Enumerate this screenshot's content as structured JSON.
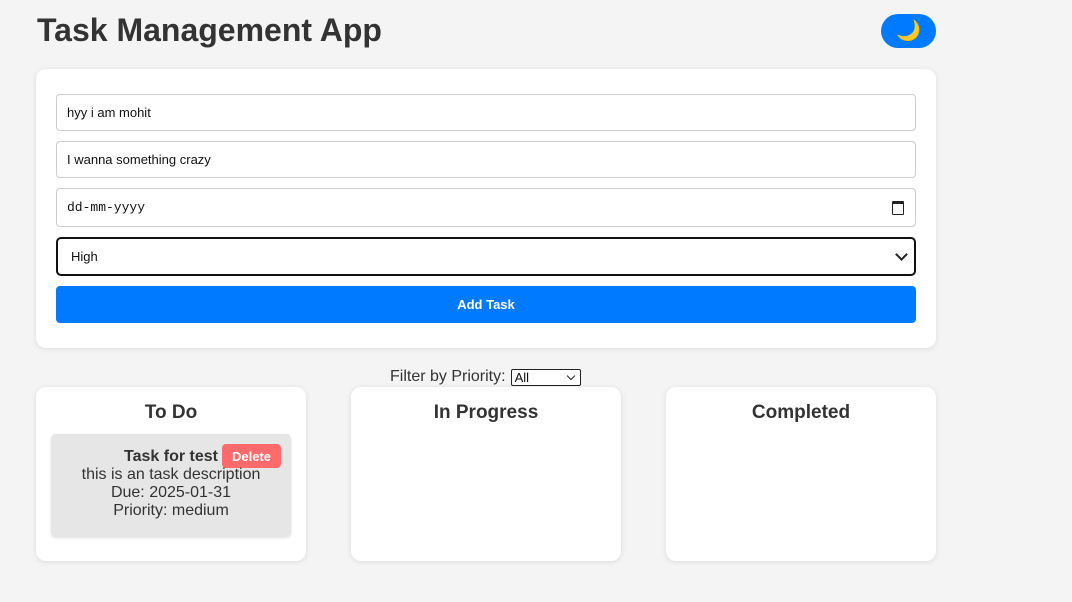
{
  "header": {
    "title": "Task Management App",
    "theme_toggle_icon": "🌙"
  },
  "form": {
    "title_value": "hyy i am mohit",
    "description_value": "I wanna something crazy",
    "date_placeholder": "dd-mm-yyyy",
    "priority_selected": "High",
    "add_label": "Add Task"
  },
  "filter": {
    "label": "Filter by Priority:",
    "selected": "All"
  },
  "columns": [
    {
      "title": "To Do",
      "tasks": [
        {
          "title": "Task for test",
          "description": "this is an task description",
          "due": "Due: 2025-01-31",
          "priority": "Priority: medium",
          "delete_label": "Delete"
        }
      ]
    },
    {
      "title": "In Progress",
      "tasks": []
    },
    {
      "title": "Completed",
      "tasks": []
    }
  ],
  "colors": {
    "accent": "#007bff",
    "danger": "#ff6b6b",
    "background": "#f4f4f4",
    "task_card": "#e6e6e6"
  }
}
